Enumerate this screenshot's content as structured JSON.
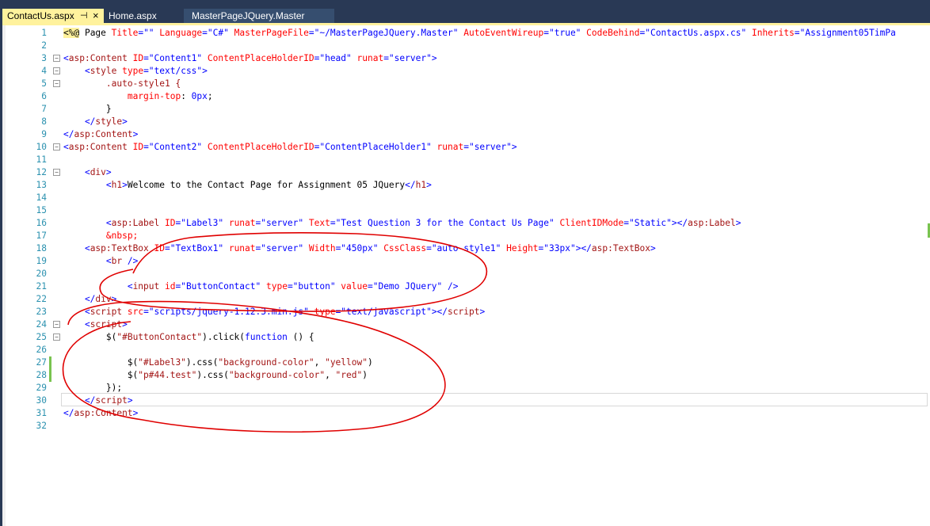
{
  "tabs": [
    {
      "label": "ContactUs.aspx",
      "active": true,
      "pin_icon": "pin-icon",
      "close_icon": "close-icon"
    },
    {
      "label": "Home.aspx",
      "active": false
    },
    {
      "label": "MasterPageJQuery.Master",
      "active": false
    }
  ],
  "lines": [
    {
      "num": "1",
      "segs": [
        {
          "t": "<%@",
          "c": "dir"
        },
        {
          "t": " Page ",
          "c": "p"
        },
        {
          "t": "Title",
          "c": "a"
        },
        {
          "t": "=\"\" ",
          "c": "s"
        },
        {
          "t": "Language",
          "c": "a"
        },
        {
          "t": "=\"C#\" ",
          "c": "s"
        },
        {
          "t": "MasterPageFile",
          "c": "a"
        },
        {
          "t": "=\"~/MasterPageJQuery.Master\" ",
          "c": "s"
        },
        {
          "t": "AutoEventWireup",
          "c": "a"
        },
        {
          "t": "=\"true\" ",
          "c": "s"
        },
        {
          "t": "CodeBehind",
          "c": "a"
        },
        {
          "t": "=\"ContactUs.aspx.cs\" ",
          "c": "s"
        },
        {
          "t": "Inherits",
          "c": "a"
        },
        {
          "t": "=\"Assignment05TimPa",
          "c": "s"
        }
      ]
    },
    {
      "num": "2",
      "segs": []
    },
    {
      "num": "3",
      "fold": true,
      "segs": [
        {
          "t": "<",
          "c": "k"
        },
        {
          "t": "asp:Content",
          "c": "e"
        },
        {
          "t": " ID",
          "c": "a"
        },
        {
          "t": "=\"Content1\" ",
          "c": "s"
        },
        {
          "t": "ContentPlaceHolderID",
          "c": "a"
        },
        {
          "t": "=\"head\" ",
          "c": "s"
        },
        {
          "t": "runat",
          "c": "a"
        },
        {
          "t": "=\"server\"",
          "c": "s"
        },
        {
          "t": ">",
          "c": "k"
        }
      ]
    },
    {
      "num": "4",
      "fold": true,
      "segs": [
        {
          "t": "    <",
          "c": "k"
        },
        {
          "t": "style",
          "c": "e"
        },
        {
          "t": " type",
          "c": "a"
        },
        {
          "t": "=\"text/css\"",
          "c": "s"
        },
        {
          "t": ">",
          "c": "k"
        }
      ]
    },
    {
      "num": "5",
      "fold": true,
      "segs": [
        {
          "t": "        .auto-style1 {",
          "c": "e"
        }
      ]
    },
    {
      "num": "6",
      "segs": [
        {
          "t": "            ",
          "c": "p"
        },
        {
          "t": "margin-top",
          "c": "a"
        },
        {
          "t": ": ",
          "c": "p"
        },
        {
          "t": "0px",
          "c": "s"
        },
        {
          "t": ";",
          "c": "p"
        }
      ]
    },
    {
      "num": "7",
      "segs": [
        {
          "t": "        }",
          "c": "p"
        }
      ]
    },
    {
      "num": "8",
      "segs": [
        {
          "t": "    </",
          "c": "k"
        },
        {
          "t": "style",
          "c": "e"
        },
        {
          "t": ">",
          "c": "k"
        }
      ]
    },
    {
      "num": "9",
      "segs": [
        {
          "t": "</",
          "c": "k"
        },
        {
          "t": "asp:Content",
          "c": "e"
        },
        {
          "t": ">",
          "c": "k"
        }
      ]
    },
    {
      "num": "10",
      "fold": true,
      "segs": [
        {
          "t": "<",
          "c": "k"
        },
        {
          "t": "asp:Content",
          "c": "e"
        },
        {
          "t": " ID",
          "c": "a"
        },
        {
          "t": "=\"Content2\" ",
          "c": "s"
        },
        {
          "t": "ContentPlaceHolderID",
          "c": "a"
        },
        {
          "t": "=\"ContentPlaceHolder1\" ",
          "c": "s"
        },
        {
          "t": "runat",
          "c": "a"
        },
        {
          "t": "=\"server\"",
          "c": "s"
        },
        {
          "t": ">",
          "c": "k"
        }
      ]
    },
    {
      "num": "11",
      "segs": []
    },
    {
      "num": "12",
      "fold": true,
      "segs": [
        {
          "t": "    <",
          "c": "k"
        },
        {
          "t": "div",
          "c": "e"
        },
        {
          "t": ">",
          "c": "k"
        }
      ]
    },
    {
      "num": "13",
      "segs": [
        {
          "t": "        <",
          "c": "k"
        },
        {
          "t": "h1",
          "c": "e"
        },
        {
          "t": ">",
          "c": "k"
        },
        {
          "t": "Welcome to the Contact Page for Assignment 05 JQuery",
          "c": "p"
        },
        {
          "t": "</",
          "c": "k"
        },
        {
          "t": "h1",
          "c": "e"
        },
        {
          "t": ">",
          "c": "k"
        }
      ]
    },
    {
      "num": "14",
      "segs": []
    },
    {
      "num": "15",
      "segs": []
    },
    {
      "num": "16",
      "segs": [
        {
          "t": "        <",
          "c": "k"
        },
        {
          "t": "asp:Label",
          "c": "e"
        },
        {
          "t": " ID",
          "c": "a"
        },
        {
          "t": "=\"Label3\" ",
          "c": "s"
        },
        {
          "t": "runat",
          "c": "a"
        },
        {
          "t": "=\"server\" ",
          "c": "s"
        },
        {
          "t": "Text",
          "c": "a"
        },
        {
          "t": "=\"Test Question 3 for the Contact Us Page\" ",
          "c": "s"
        },
        {
          "t": "ClientIDMode",
          "c": "a"
        },
        {
          "t": "=\"Static\"",
          "c": "s"
        },
        {
          "t": "></",
          "c": "k"
        },
        {
          "t": "asp:Label",
          "c": "e"
        },
        {
          "t": ">",
          "c": "k"
        }
      ]
    },
    {
      "num": "17",
      "segs": [
        {
          "t": "        &nbsp;",
          "c": "a"
        }
      ]
    },
    {
      "num": "18",
      "segs": [
        {
          "t": "    <",
          "c": "k"
        },
        {
          "t": "asp:TextBox",
          "c": "e"
        },
        {
          "t": " ID",
          "c": "a"
        },
        {
          "t": "=\"TextBox1\" ",
          "c": "s"
        },
        {
          "t": "runat",
          "c": "a"
        },
        {
          "t": "=\"server\" ",
          "c": "s"
        },
        {
          "t": "Width",
          "c": "a"
        },
        {
          "t": "=\"450px\" ",
          "c": "s"
        },
        {
          "t": "CssClass",
          "c": "a"
        },
        {
          "t": "=\"auto-style1\" ",
          "c": "s"
        },
        {
          "t": "Height",
          "c": "a"
        },
        {
          "t": "=\"33px\"",
          "c": "s"
        },
        {
          "t": "></",
          "c": "k"
        },
        {
          "t": "asp:TextBox",
          "c": "e"
        },
        {
          "t": ">",
          "c": "k"
        }
      ]
    },
    {
      "num": "19",
      "segs": [
        {
          "t": "        <",
          "c": "k"
        },
        {
          "t": "br",
          "c": "e"
        },
        {
          "t": " />",
          "c": "k"
        }
      ]
    },
    {
      "num": "20",
      "segs": []
    },
    {
      "num": "21",
      "segs": [
        {
          "t": "            <",
          "c": "k"
        },
        {
          "t": "input",
          "c": "e"
        },
        {
          "t": " id",
          "c": "a"
        },
        {
          "t": "=\"ButtonContact\" ",
          "c": "s"
        },
        {
          "t": "type",
          "c": "a"
        },
        {
          "t": "=\"button\" ",
          "c": "s"
        },
        {
          "t": "value",
          "c": "a"
        },
        {
          "t": "=\"Demo JQuery\"",
          "c": "s"
        },
        {
          "t": " />",
          "c": "k"
        }
      ]
    },
    {
      "num": "22",
      "segs": [
        {
          "t": "    </",
          "c": "k"
        },
        {
          "t": "div",
          "c": "e"
        },
        {
          "t": ">",
          "c": "k"
        }
      ]
    },
    {
      "num": "23",
      "segs": [
        {
          "t": "    <",
          "c": "k"
        },
        {
          "t": "script",
          "c": "e"
        },
        {
          "t": " src",
          "c": "a"
        },
        {
          "t": "=\"scripts/jquery-1.12.3.min.js\" ",
          "c": "s"
        },
        {
          "t": "type",
          "c": "a"
        },
        {
          "t": "=\"text/javascript\"",
          "c": "s"
        },
        {
          "t": "></",
          "c": "k"
        },
        {
          "t": "script",
          "c": "e"
        },
        {
          "t": ">",
          "c": "k"
        }
      ]
    },
    {
      "num": "24",
      "fold": true,
      "segs": [
        {
          "t": "    <",
          "c": "k"
        },
        {
          "t": "script",
          "c": "e"
        },
        {
          "t": ">",
          "c": "k"
        }
      ]
    },
    {
      "num": "25",
      "fold": true,
      "segs": [
        {
          "t": "        $(",
          "c": "p"
        },
        {
          "t": "\"#ButtonContact\"",
          "c": "e"
        },
        {
          "t": ").click(",
          "c": "p"
        },
        {
          "t": "function",
          "c": "k"
        },
        {
          "t": " () {",
          "c": "p"
        }
      ]
    },
    {
      "num": "26",
      "segs": []
    },
    {
      "num": "27",
      "mark": true,
      "segs": [
        {
          "t": "            $(",
          "c": "p"
        },
        {
          "t": "\"#Label3\"",
          "c": "e"
        },
        {
          "t": ").css(",
          "c": "p"
        },
        {
          "t": "\"background-color\"",
          "c": "e"
        },
        {
          "t": ", ",
          "c": "p"
        },
        {
          "t": "\"yellow\"",
          "c": "e"
        },
        {
          "t": ")",
          "c": "p"
        }
      ]
    },
    {
      "num": "28",
      "mark": true,
      "segs": [
        {
          "t": "            $(",
          "c": "p"
        },
        {
          "t": "\"p#44.test\"",
          "c": "e"
        },
        {
          "t": ").css(",
          "c": "p"
        },
        {
          "t": "\"background-color\"",
          "c": "e"
        },
        {
          "t": ", ",
          "c": "p"
        },
        {
          "t": "\"red\"",
          "c": "e"
        },
        {
          "t": ")",
          "c": "p"
        }
      ]
    },
    {
      "num": "29",
      "segs": [
        {
          "t": "        });",
          "c": "p"
        }
      ]
    },
    {
      "num": "30",
      "segs": [
        {
          "t": "    </",
          "c": "k"
        },
        {
          "t": "script",
          "c": "e"
        },
        {
          "t": ">",
          "c": "k"
        }
      ]
    },
    {
      "num": "31",
      "segs": [
        {
          "t": "</",
          "c": "k"
        },
        {
          "t": "asp:Content",
          "c": "e"
        },
        {
          "t": ">",
          "c": "k"
        }
      ]
    },
    {
      "num": "32",
      "segs": []
    }
  ],
  "colors": {
    "accent_tab": "#fff29d",
    "chrome": "#293955",
    "annotation": "#e00000"
  }
}
